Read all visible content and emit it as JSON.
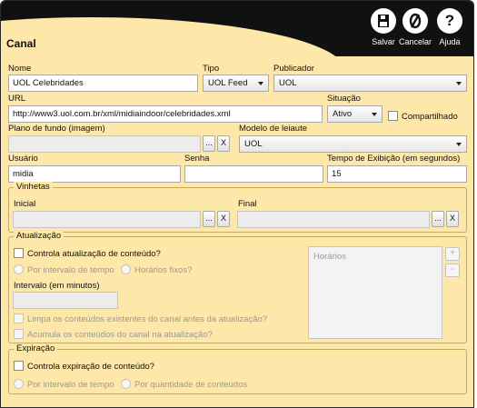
{
  "header": {
    "title": "Canal"
  },
  "toolbar": {
    "save_label": "Salvar",
    "cancel_label": "Cancelar",
    "help_label": "Ajuda"
  },
  "fields": {
    "nome_label": "Nome",
    "nome_value": "UOL Celebridades",
    "tipo_label": "Tipo",
    "tipo_value": "UOL Feed",
    "publicador_label": "Publicador",
    "publicador_value": "UOL",
    "url_label": "URL",
    "url_value": "http://www3.uol.com.br/xml/midiaindoor/celebridades.xml",
    "situacao_label": "Situação",
    "situacao_value": "Ativo",
    "compartilhado_label": "Compartilhado",
    "plano_label": "Plano de fundo (imagem)",
    "modelo_label": "Modelo de leiaute",
    "modelo_value": "UOL",
    "usuario_label": "Usuário",
    "usuario_value": "midia",
    "senha_label": "Senha",
    "tempo_label": "Tempo de Exibição (em segundos)",
    "tempo_value": "15",
    "browse_label": "...",
    "clear_label": "X"
  },
  "vinhetas": {
    "title": "Vinhetas",
    "inicial_label": "Inicial",
    "final_label": "Final"
  },
  "atualizacao": {
    "title": "Atualização",
    "controla_label": "Controla atualização de conteúdo?",
    "por_intervalo_label": "Por intervalo de tempo",
    "horarios_fixos_label": "Horários fixos?",
    "intervalo_label": "Intervalo (em minutos)",
    "limpa_label": "Limpa os conteúdos existentes do canal antes da atualização?",
    "acumula_label": "Acumula os conteúdos do canal na atualização?",
    "horarios_header": "Horários",
    "add_label": "+",
    "remove_label": "-"
  },
  "expiracao": {
    "title": "Expiração",
    "controla_label": "Controla expiração de conteúdo?",
    "por_intervalo_label": "Por intervalo de tempo",
    "por_quantidade_label": "Por quantidade de conteúdos"
  },
  "icons": {
    "save": "save-disk-icon",
    "cancel": "cancel-slash-icon",
    "help": "help-question-icon"
  }
}
